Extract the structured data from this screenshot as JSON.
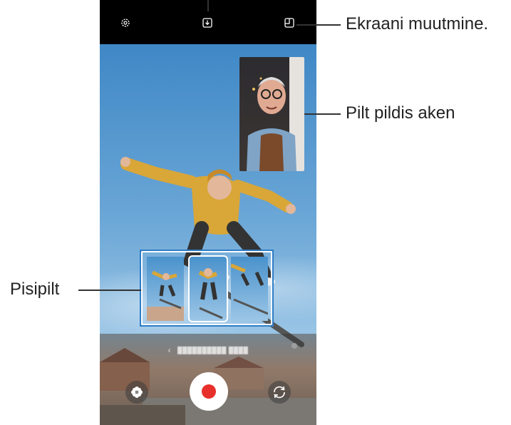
{
  "callouts": {
    "screen_change": "Ekraani muutmine.",
    "pip_window": "Pilt pildis aken",
    "thumbnail": "Pisipilt"
  },
  "icons": {
    "settings": "gear-icon",
    "save": "download-icon",
    "screen_layout": "screen-layout-icon",
    "effects": "flower-icon",
    "record": "record-icon",
    "switch_camera": "rotate-camera-icon",
    "back": "chevron-left-icon"
  },
  "colors": {
    "accent": "#2e7dc7",
    "record": "#e7302b"
  }
}
